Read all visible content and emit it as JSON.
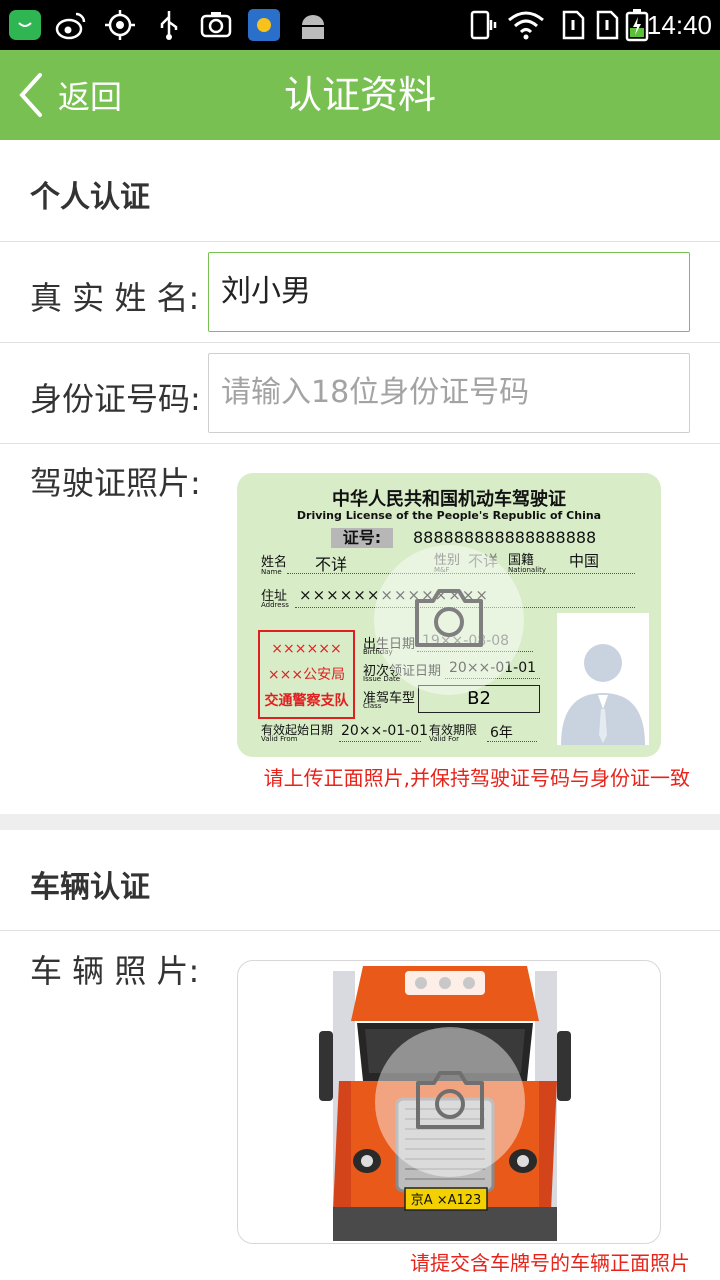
{
  "status_bar": {
    "time": "14:40",
    "left_icons": [
      "app-store-icon",
      "weibo-icon",
      "location-icon",
      "usb-icon",
      "camera-icon",
      "weather-icon",
      "android-icon"
    ],
    "right_icons": [
      "vibrate-icon",
      "wifi-icon",
      "sim-1-icon",
      "sim-2-icon",
      "battery-icon"
    ]
  },
  "header": {
    "back_label": "返回",
    "title": "认证资料"
  },
  "personal": {
    "section_title": "个人认证",
    "name_label": "真 实 姓 名:",
    "name_value": "刘小男",
    "id_label": "身份证号码:",
    "id_placeholder": "请输入18位身份证号码",
    "license_label": "驾驶证照片:",
    "license_hint": "请上传正面照片,并保持驾驶证号码与身份证一致"
  },
  "license_card": {
    "title_cn": "中华人民共和国机动车驾驶证",
    "title_en": "Driving License of the People's Republic of China",
    "number_label": "证号:",
    "number_value": "888888888888888888",
    "name_label": "姓名",
    "name_label_en": "Name",
    "name_value": "不详",
    "sex_label": "性别",
    "sex_label_en": "M&F",
    "sex_value": "不详",
    "nationality_label": "国籍",
    "nationality_label_en": "Nationality",
    "nationality_value": "中国",
    "address_label": "住址",
    "address_label_en": "Address",
    "address_value": "××××××××××××××",
    "stamp_line1": "××××××",
    "stamp_line2": "×××公安局",
    "stamp_line3": "交通警察支队",
    "birth_label": "出生日期",
    "birth_label_en": "Birthday",
    "birth_value": "19××-08-08",
    "issue_label": "初次领证日期",
    "issue_label_en": "Issue Date",
    "issue_value": "20××-01-01",
    "class_label": "准驾车型",
    "class_label_en": "Class",
    "class_value": "B2",
    "valid_from_label": "有效起始日期",
    "valid_from_label_en": "Valid From",
    "valid_from_value": "20××-01-01",
    "valid_for_label": "有效期限",
    "valid_for_label_en": "Valid For",
    "valid_for_value": "6年"
  },
  "vehicle": {
    "section_title": "车辆认证",
    "photo_label": "车 辆 照 片:",
    "plate": "京A ×A123",
    "hint": "请提交含车牌号的车辆正面照片"
  },
  "colors": {
    "accent": "#79c053",
    "hint_red": "#e8231a",
    "truck_orange": "#e8591a"
  }
}
